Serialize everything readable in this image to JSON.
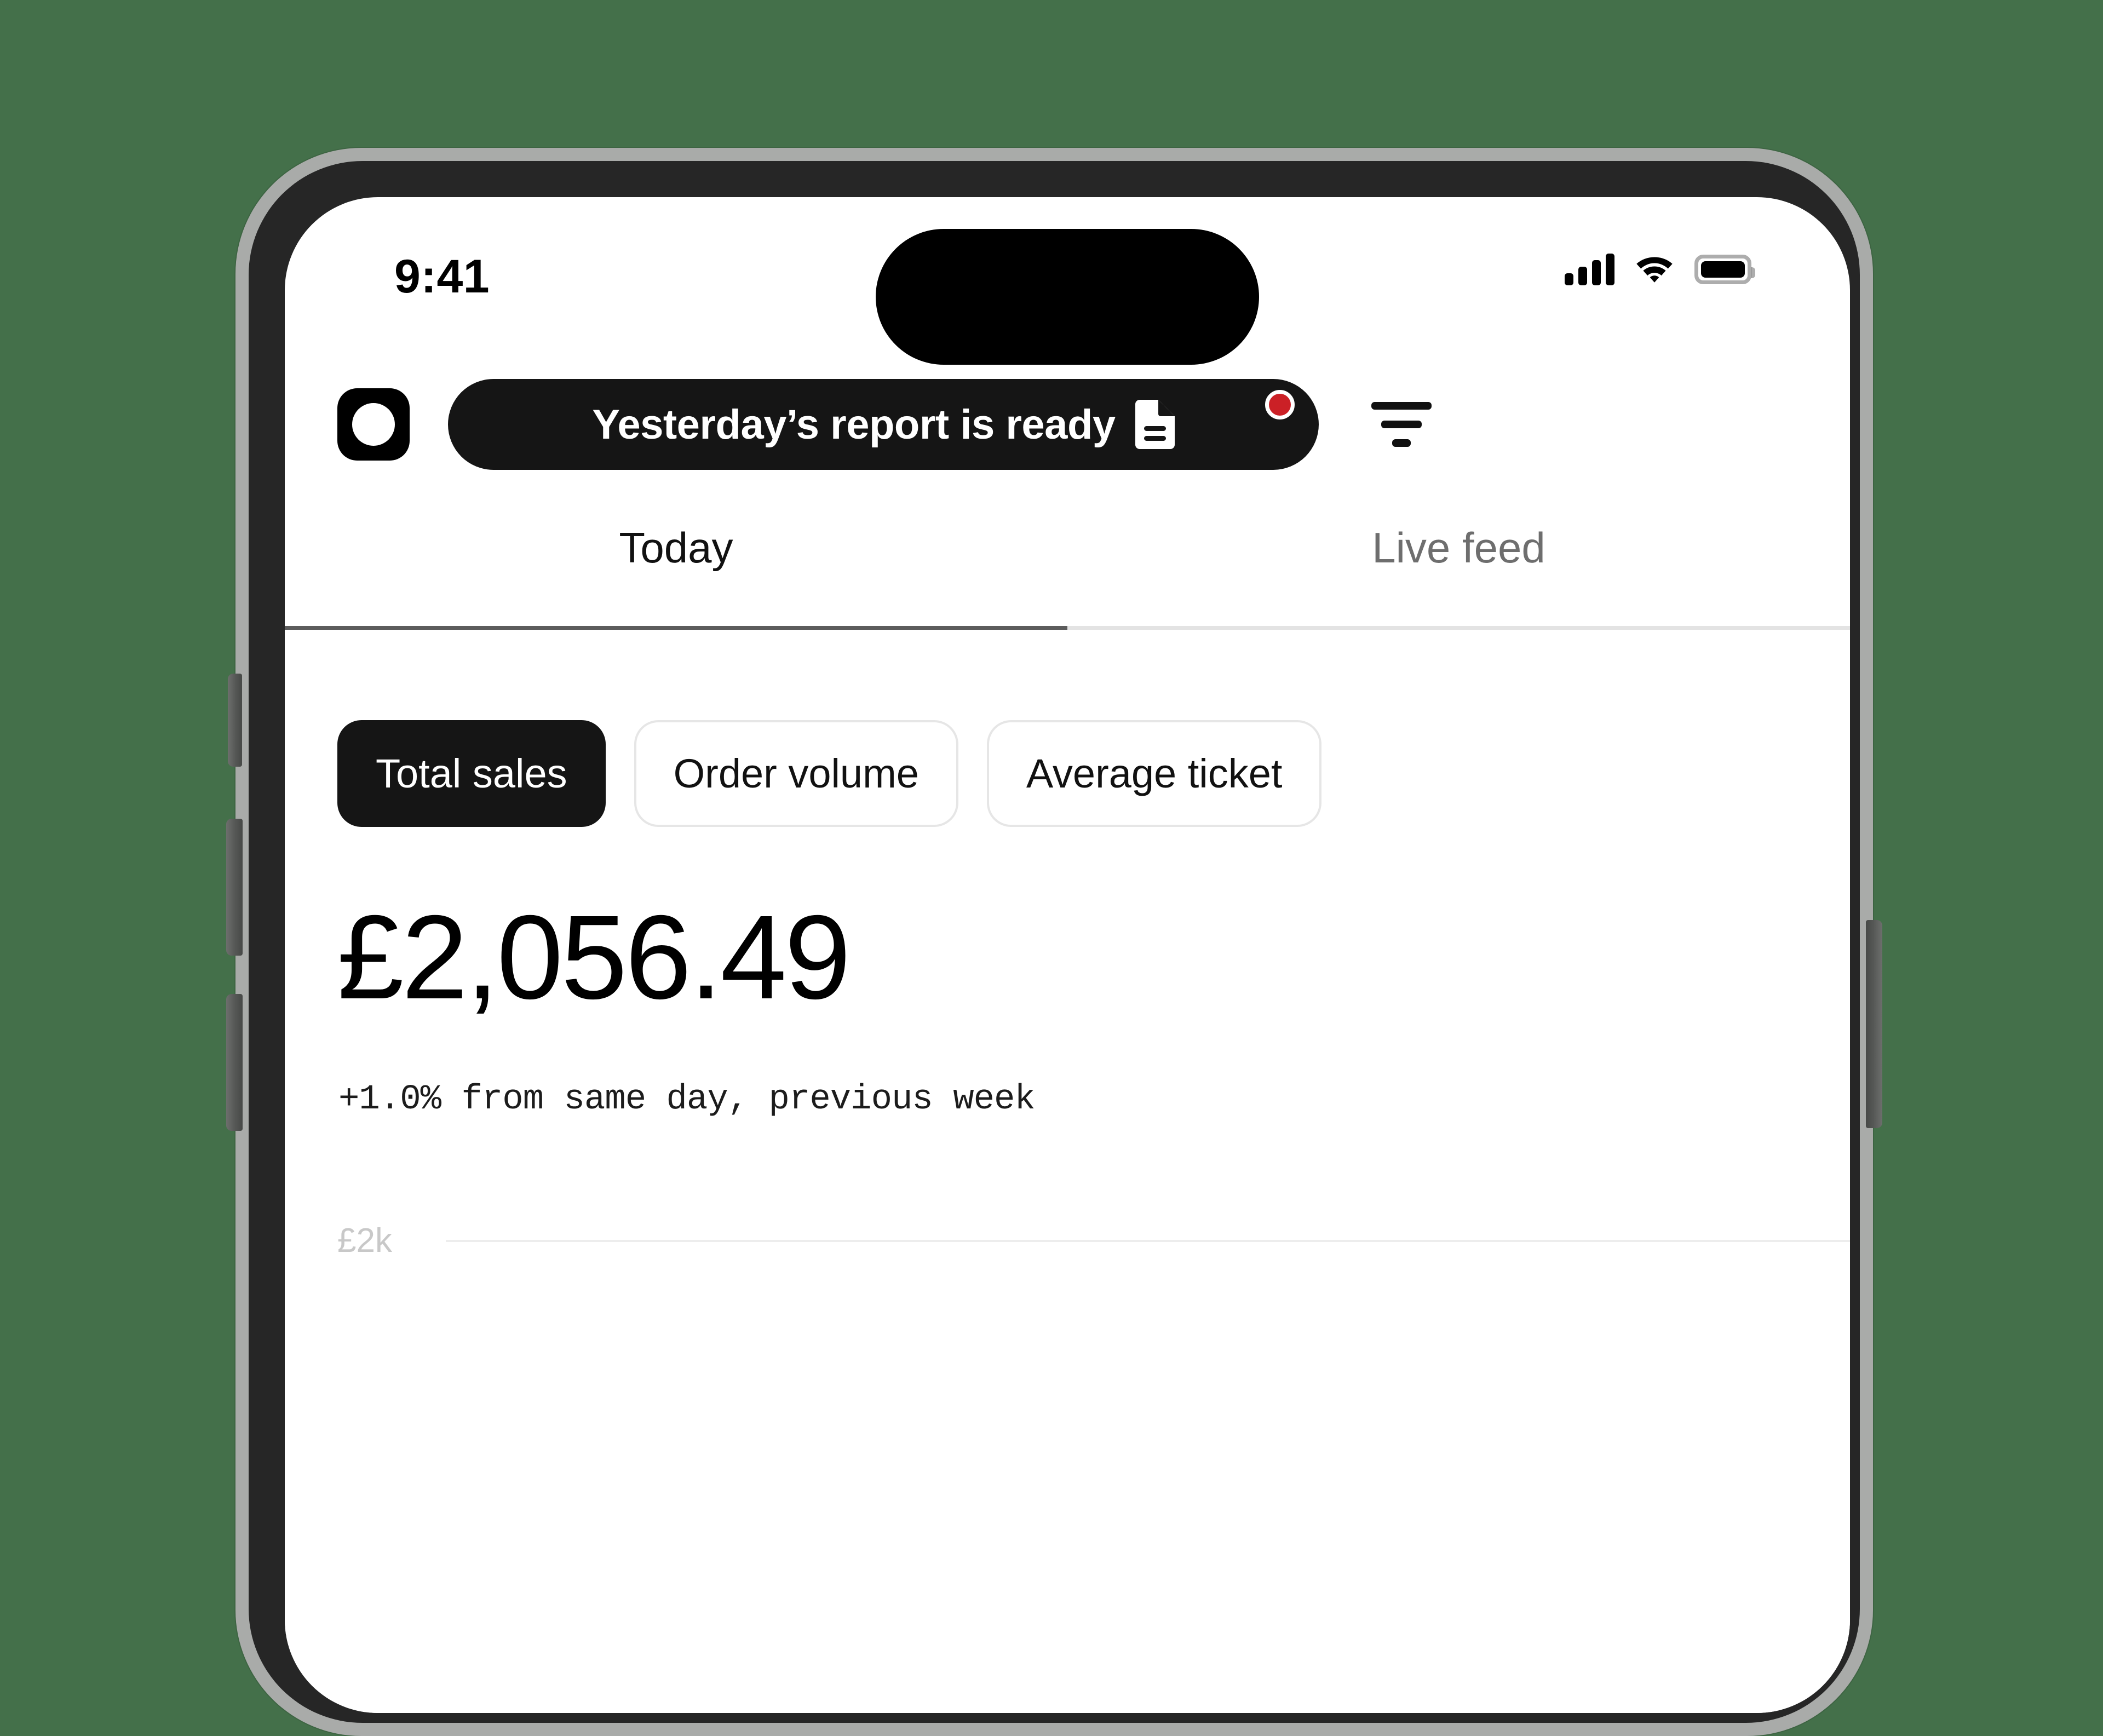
{
  "device": {
    "frame": "iphone",
    "frame_color": "#a9aba9",
    "bezel_color": "#262626",
    "background_color": "#44704a"
  },
  "status_bar": {
    "time": "9:41",
    "cellular_icon": "cellular-bars-icon",
    "cellular_bars": 4,
    "wifi_icon": "wifi-icon",
    "battery_icon": "battery-icon",
    "battery_level_percent": 100
  },
  "header": {
    "logo_icon": "app-logo-icon",
    "notification": {
      "text": "Yesterday’s report is ready",
      "doc_icon": "document-icon",
      "badge_color": "#cb2026",
      "badge_icon": "notification-dot-icon",
      "background_color": "#151515"
    },
    "filter_icon": "filter-icon"
  },
  "tabs": [
    {
      "label": "Today",
      "active": true
    },
    {
      "label": "Live feed",
      "active": false
    }
  ],
  "metric_chips": [
    {
      "label": "Total sales",
      "selected": true
    },
    {
      "label": "Order volume",
      "selected": false
    },
    {
      "label": "Average ticket",
      "selected": false
    }
  ],
  "metric": {
    "value": "£2,056.49",
    "delta": "+1.0% from same day, previous week"
  },
  "chart_data": {
    "type": "line",
    "title": "",
    "xlabel": "",
    "ylabel": "",
    "grid": true,
    "legend": null,
    "y_tick_labels": [
      "£2k"
    ],
    "y_ticks": [
      2000
    ],
    "series": [
      {
        "name": "Total sales",
        "values": []
      }
    ],
    "note": "Only the £2k gridline is visible; chart body is cut off below the screenshot crop."
  }
}
